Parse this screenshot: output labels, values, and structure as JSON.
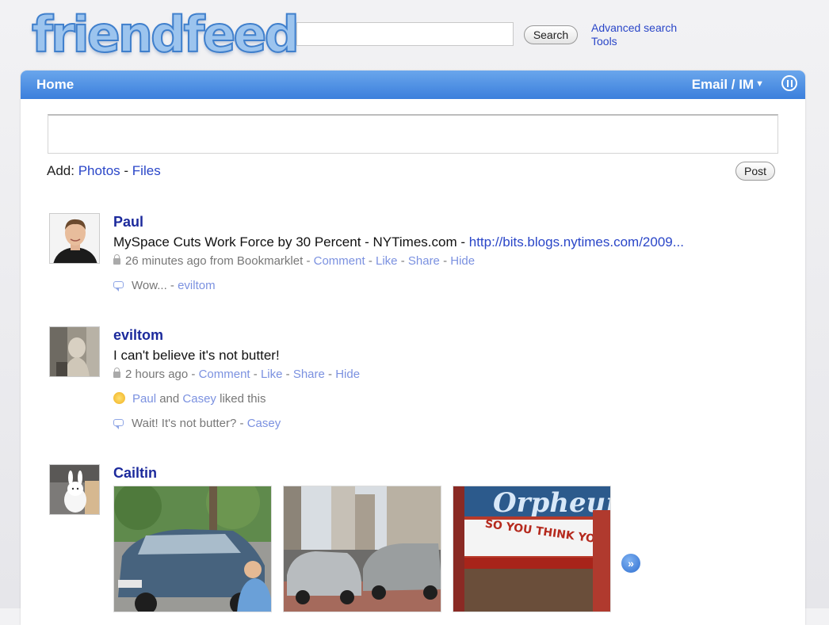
{
  "header": {
    "logo_text": "friendfeed",
    "search_value": "",
    "search_button": "Search",
    "advanced_search": "Advanced search",
    "tools": "Tools"
  },
  "tabs": {
    "home": "Home",
    "email_im": "Email / IM",
    "pause_icon": "pause-icon"
  },
  "composer": {
    "value": "",
    "add_label": "Add:",
    "photos_link": "Photos",
    "separator": "-",
    "files_link": "Files",
    "post_button": "Post"
  },
  "entries": [
    {
      "author": "Paul",
      "title": "MySpace Cuts Work Force by 30 Percent - NYTimes.com - ",
      "link": "http://bits.blogs.nytimes.com/2009...",
      "time": "26 minutes ago from Bookmarklet",
      "actions": [
        "Comment",
        "Like",
        "Share",
        "Hide"
      ],
      "comments": [
        {
          "text": "Wow...",
          "by": "eviltom"
        }
      ]
    },
    {
      "author": "eviltom",
      "title": "I can't believe it's not butter!",
      "time": "2 hours ago",
      "actions": [
        "Comment",
        "Like",
        "Share",
        "Hide"
      ],
      "likes": {
        "user1": "Paul",
        "and": "and",
        "user2": "Casey",
        "suffix": "liked this"
      },
      "comments": [
        {
          "text": "Wait! It's not butter?",
          "by": "Casey"
        }
      ]
    },
    {
      "author": "Cailtin",
      "photos": [
        "car-street-photo",
        "street-cars-photo",
        "orpheum-theater-photo"
      ],
      "marquee_text": "SO YOU THINK YOU CAN DANCE",
      "sign_text": "Orpheum"
    }
  ],
  "colors": {
    "tabbar": "#3b7fdc",
    "link": "#2a46c8",
    "meta_link": "#7b91e0",
    "author": "#1c2a9c"
  }
}
